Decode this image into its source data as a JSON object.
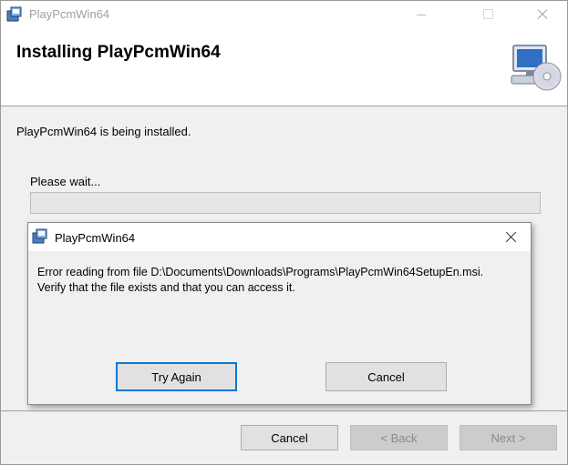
{
  "window": {
    "title": "PlayPcmWin64",
    "icon": "installer-package-icon"
  },
  "header": {
    "title": "Installing PlayPcmWin64",
    "icon": "computer-cd-icon"
  },
  "body": {
    "status_text": "PlayPcmWin64 is being installed.",
    "wait_label": "Please wait...",
    "progress": 0
  },
  "footer": {
    "cancel_label": "Cancel",
    "back_label": "< Back",
    "next_label": "Next >"
  },
  "dialog": {
    "title": "PlayPcmWin64",
    "icon": "installer-package-icon",
    "message_line1": "Error reading from file D:\\Documents\\Downloads\\Programs\\PlayPcmWin64SetupEn.msi.",
    "message_line2": "Verify that the file exists and that you can access it.",
    "try_again_label": "Try Again",
    "cancel_label": "Cancel",
    "focus_color": "#0078d7"
  }
}
